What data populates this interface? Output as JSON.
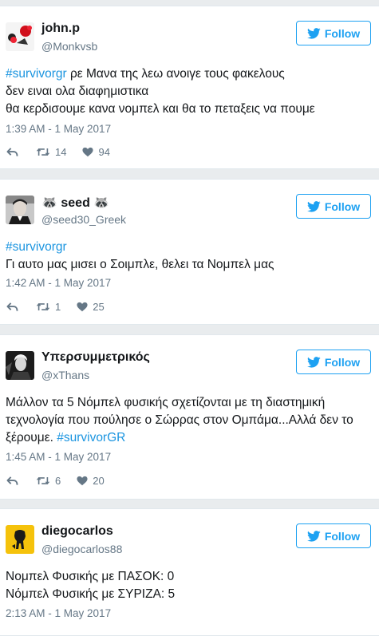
{
  "brand_color": "#1da1f2",
  "tweets": [
    {
      "name": "john.p",
      "handle": "@Monkvsb",
      "follow_label": "Follow",
      "hashtag": "#survivorgr",
      "text_lines": [
        " ρε Μανα της λεω ανοιγε τους φακελους",
        "δεν ειναι ολα διαφημιστικα",
        "θα κερδισουμε κανα νομπελ και θα το πεταξεις να πουμε"
      ],
      "time": "1:39 AM - 1 May 2017",
      "retweets": "14",
      "likes": "94"
    },
    {
      "name": "🦝 seed 🦝",
      "handle": "@seed30_Greek",
      "follow_label": "Follow",
      "hashtag": "#survivorgr",
      "text_lines": [
        "Γι αυτο μας μισει ο Σοιμπλε, θελει τα Νομπελ μας"
      ],
      "time": "1:42 AM - 1 May 2017",
      "retweets": "1",
      "likes": "25"
    },
    {
      "name": "Υπερσυμμετρικός",
      "handle": "@xThans",
      "follow_label": "Follow",
      "text_lines": [
        "Μάλλον τα 5 Νόμπελ φυσικής σχετίζονται με τη διαστημική",
        "τεχνολογία που πούλησε ο Σώρρας στον Ομπάμα...Αλλά δεν το",
        "ξέρουμε. "
      ],
      "hashtag": "#survivorGR",
      "time": "1:45 AM - 1 May 2017",
      "retweets": "6",
      "likes": "20"
    },
    {
      "name": "diegocarlos",
      "handle": "@diegocarlos88",
      "follow_label": "Follow",
      "text_lines": [
        "Νομπελ Φυσικής με ΠΑΣΟΚ: 0",
        "Νόμπελ Φυσικής με ΣΥΡΙΖΑ: 5"
      ],
      "time": "2:13 AM - 1 May 2017"
    }
  ]
}
